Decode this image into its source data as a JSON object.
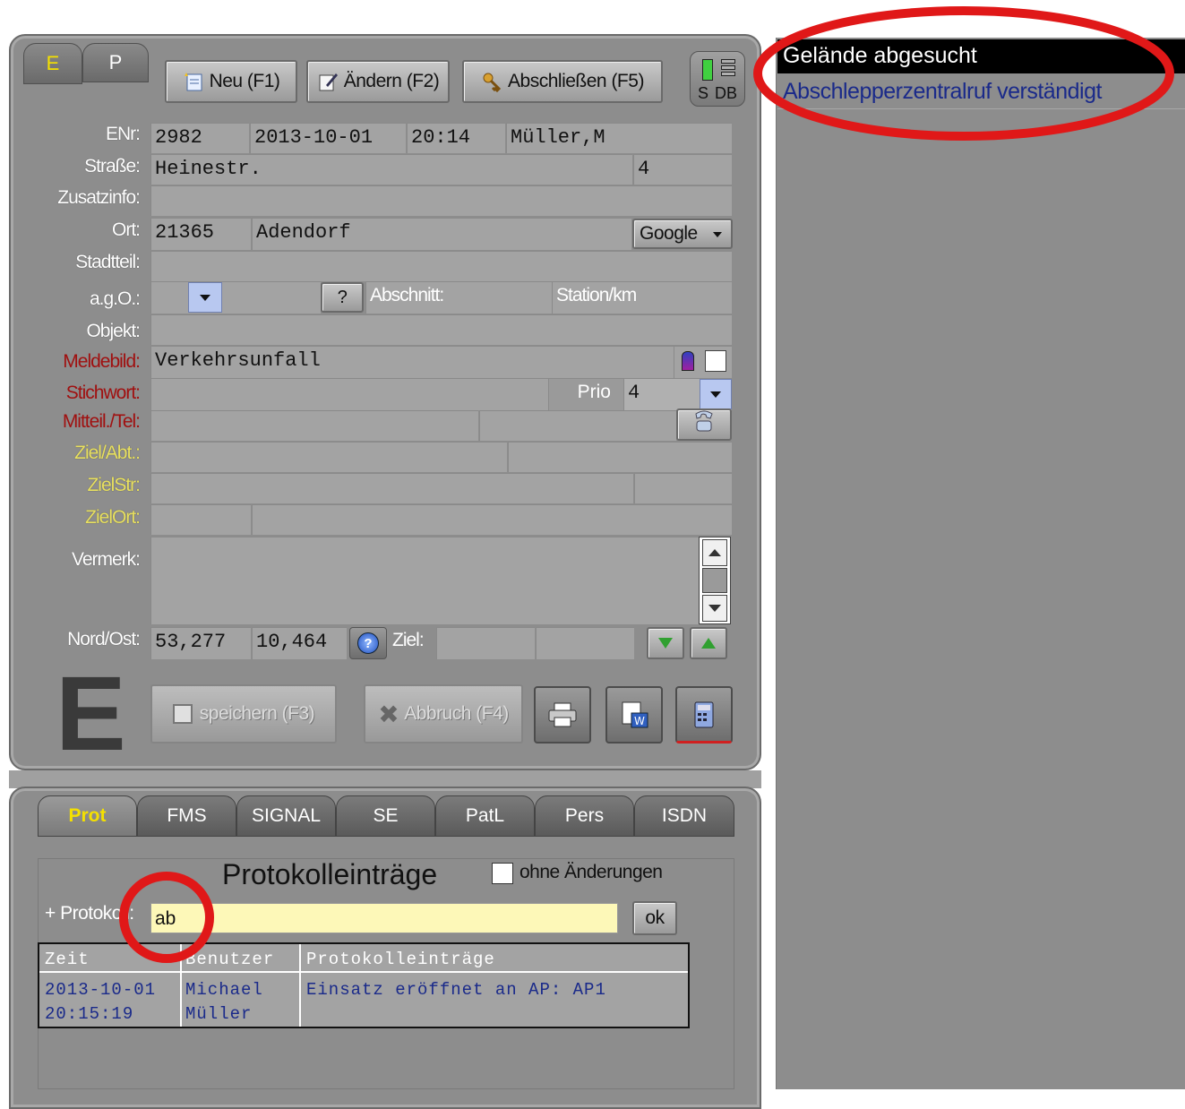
{
  "top_tabs": {
    "e": "E",
    "p": "P"
  },
  "toolbar": {
    "new_label": "Neu (F1)",
    "edit_label": "Ändern (F2)",
    "close_label": "Abschließen (F5)",
    "indicator_s": "S",
    "indicator_db": "DB"
  },
  "form": {
    "labels": {
      "enr": "ENr:",
      "strasse": "Straße:",
      "zusatzinfo": "Zusatzinfo:",
      "ort": "Ort:",
      "stadtteil": "Stadtteil:",
      "ago": "a.g.O.:",
      "objekt": "Objekt:",
      "meldebild": "Meldebild:",
      "stichwort": "Stichwort:",
      "mitteil": "Mitteil./Tel:",
      "ziel_abt": "Ziel/Abt.:",
      "zielstr": "ZielStr:",
      "zielort": "ZielOrt:",
      "vermerk": "Vermerk:",
      "nord_ost": "Nord/Ost:"
    },
    "enr": "2982",
    "date": "2013-10-01",
    "time": "20:14",
    "user": "Müller,M",
    "street": "Heinestr.",
    "house_no": "4",
    "zip": "21365",
    "city": "Adendorf",
    "map_select": "Google",
    "question_button": "?",
    "abschnitt_label": "Abschnitt:",
    "station_label": "Station/km",
    "meldebild": "Verkehrsunfall",
    "prio_label": "Prio",
    "prio_value": "4",
    "nord": "53,277",
    "ost": "10,464",
    "ziel_label": "Ziel:"
  },
  "mode_letter": "E",
  "actions": {
    "save_label": "speichern (F3)",
    "cancel_label": "Abbruch (F4)"
  },
  "bottom_tabs": [
    {
      "label": "Prot"
    },
    {
      "label": "FMS"
    },
    {
      "label": "SIGNAL"
    },
    {
      "label": "SE"
    },
    {
      "label": "PatL"
    },
    {
      "label": "Pers"
    },
    {
      "label": "ISDN"
    }
  ],
  "protocol": {
    "title": "Protokolleinträge",
    "no_changes_label": "ohne Änderungen",
    "input_label": "+ Protokoll:",
    "input_value": "ab",
    "ok_label": "ok",
    "columns": [
      "Zeit",
      "Benutzer",
      "Protokolleinträge"
    ],
    "rows": [
      {
        "zeit_date": "2013-10-01",
        "zeit_time": "20:15:19",
        "user_first": "Michael",
        "user_last": "Müller",
        "entry": "Einsatz eröffnet an AP: AP1"
      }
    ]
  },
  "suggestions": [
    {
      "label": "Gelände abgesucht",
      "selected": true
    },
    {
      "label": "Abschlepperzentralruf verständigt",
      "selected": false
    }
  ],
  "colors": {
    "panel": "#8d8d8d",
    "highlight_circle": "#e01818",
    "suggestion_link": "#1a2a8a"
  }
}
